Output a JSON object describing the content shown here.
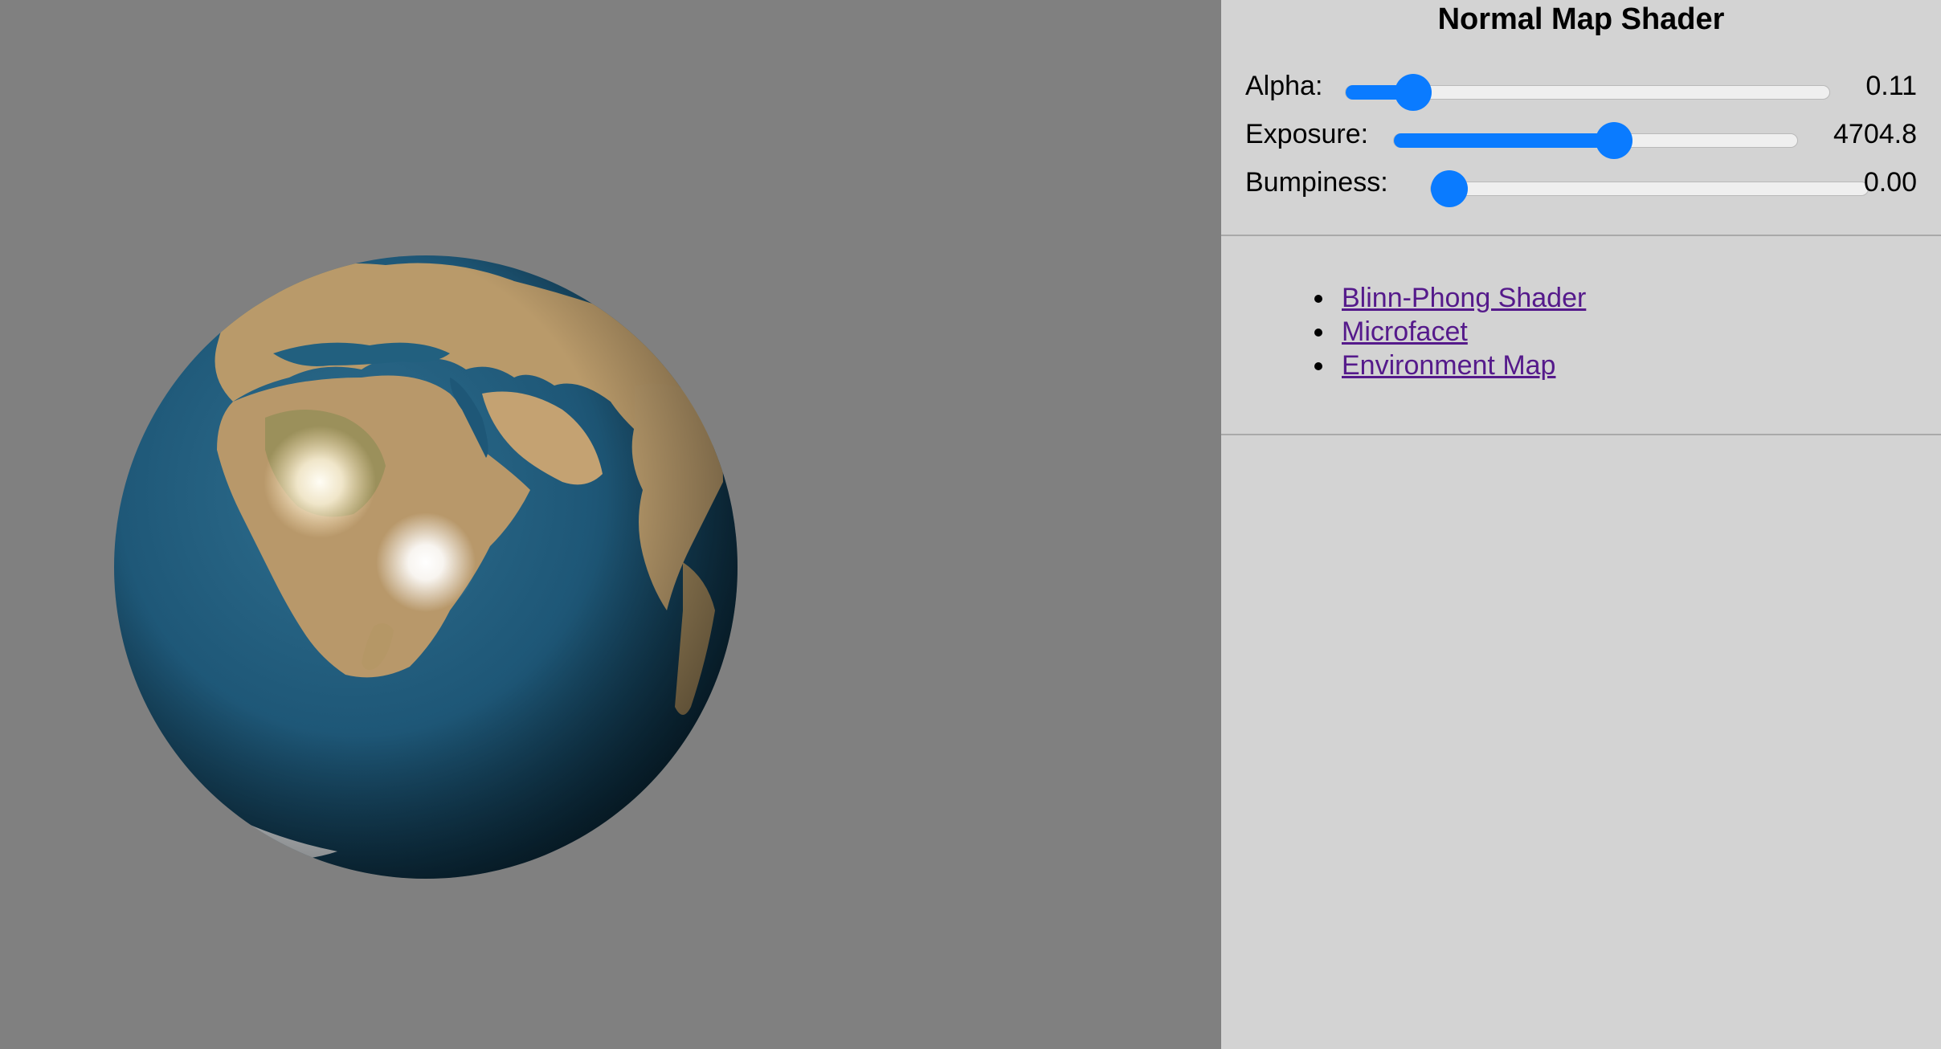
{
  "title": "Normal Map Shader",
  "controls": [
    {
      "label": "Alpha:",
      "value": "0.11",
      "fraction": 0.11
    },
    {
      "label": "Exposure:",
      "value": "4704.8",
      "fraction": 0.55
    },
    {
      "label": "Bumpiness:",
      "value": "0.00",
      "fraction": 0.0
    }
  ],
  "links": [
    {
      "label": "Blinn-Phong Shader"
    },
    {
      "label": "Microfacet"
    },
    {
      "label": "Environment Map"
    }
  ],
  "colors": {
    "canvas_background": "#808080",
    "panel_background": "#d3d3d3",
    "slider_accent": "#0a7bff",
    "link_visited": "#551a8b"
  }
}
